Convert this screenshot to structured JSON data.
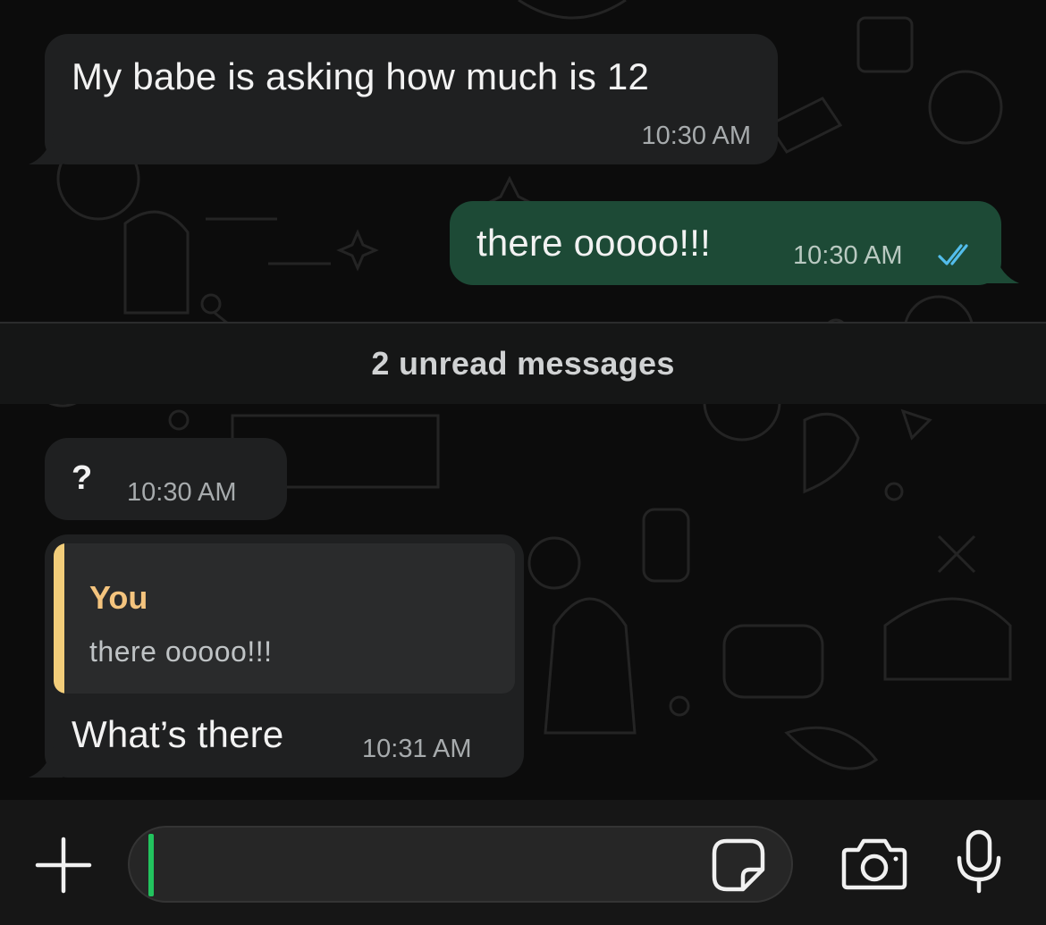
{
  "chat": {
    "messages": [
      {
        "direction": "incoming",
        "text": "My babe is asking how much is 12",
        "time": "10:30 AM"
      },
      {
        "direction": "outgoing",
        "text": "there ooooo!!!",
        "time": "10:30 AM",
        "status": "read-double-check-icon"
      },
      {
        "direction": "incoming",
        "text": "?",
        "time": "10:30 AM"
      },
      {
        "direction": "incoming",
        "text": "What’s there",
        "time": "10:31 AM",
        "reply_to": {
          "author": "You",
          "text": "there ooooo!!!"
        }
      }
    ],
    "unread_divider": "2 unread messages"
  },
  "composer": {
    "icons": [
      "plus-icon",
      "sticker-icon",
      "camera-icon",
      "microphone-icon"
    ]
  },
  "colors": {
    "incoming_bubble": "#1f2021",
    "outgoing_bubble": "#1d4a36",
    "read_ticks": "#53bdeb",
    "reply_accent": "#f2cd7a",
    "caret": "#22c35e"
  }
}
